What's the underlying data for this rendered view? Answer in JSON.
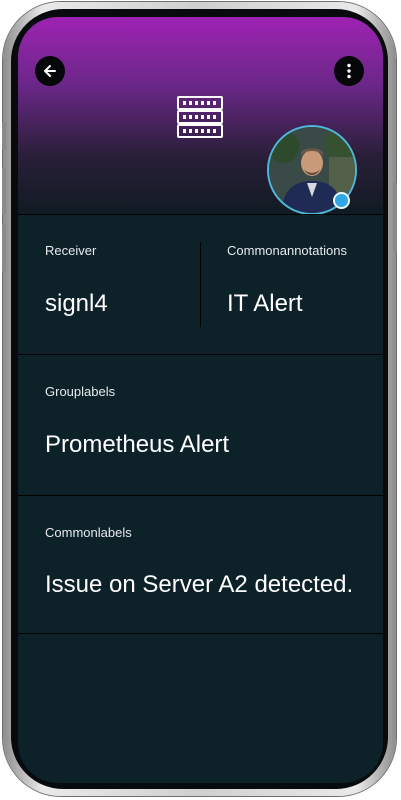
{
  "header": {
    "back_icon": "arrow-left-icon",
    "menu_icon": "more-vertical-icon",
    "type_icon": "server-rack-icon",
    "status_color": "#2ea6e8"
  },
  "fields": {
    "receiver": {
      "label": "Receiver",
      "value": "signl4"
    },
    "commonannotations": {
      "label": "Commonannotations",
      "value": "IT Alert"
    },
    "grouplabels": {
      "label": "Grouplabels",
      "value": "Prometheus Alert"
    },
    "commonlabels": {
      "label": "Commonlabels",
      "value": "Issue on Server A2 detected."
    }
  },
  "colors": {
    "accent": "#9e22b3",
    "background": "#0d2129"
  }
}
